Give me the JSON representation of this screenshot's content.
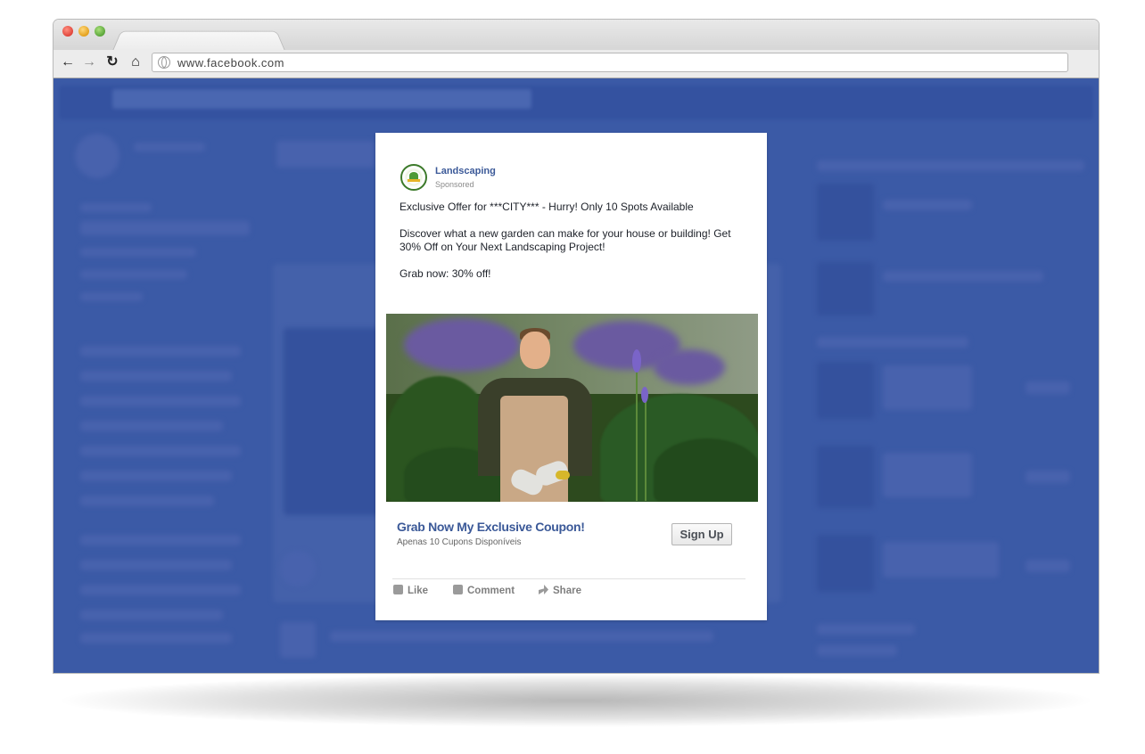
{
  "browser": {
    "url": "www.facebook.com"
  },
  "ad": {
    "page_name": "Landscaping",
    "sponsored_label": "Sponsored",
    "headline_line": "Exclusive Offer for ***CITY*** - Hurry! Only 10 Spots Available",
    "description": "Discover what a new garden can make for your house or building! Get 30% Off on Your Next Landscaping Project!",
    "grab_line": "Grab now: 30% off!",
    "cta_headline": "Grab Now My Exclusive Coupon!",
    "cta_sub": "Apenas 10 Cupons Disponíveis",
    "cta_button": "Sign Up",
    "actions": {
      "like": "Like",
      "comment": "Comment",
      "share": "Share"
    }
  },
  "colors": {
    "page_overlay": "#3b5aa6",
    "link_blue": "#3b5998"
  }
}
